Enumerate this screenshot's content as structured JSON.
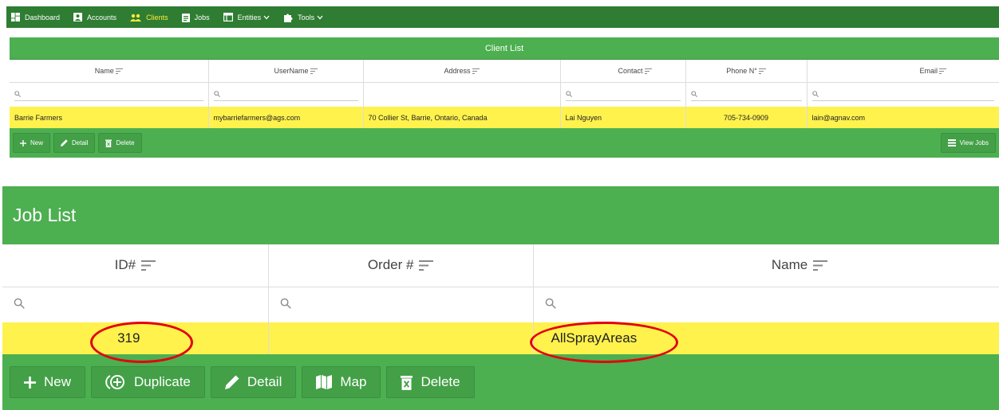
{
  "nav": {
    "items": [
      {
        "label": "Dashboard",
        "icon": "dashboard-icon"
      },
      {
        "label": "Accounts",
        "icon": "account-box-icon"
      },
      {
        "label": "Clients",
        "icon": "people-icon",
        "active": true
      },
      {
        "label": "Jobs",
        "icon": "clipboard-icon"
      },
      {
        "label": "Entities",
        "icon": "table-icon",
        "dropdown": true
      },
      {
        "label": "Tools",
        "icon": "puzzle-icon",
        "dropdown": true
      }
    ]
  },
  "client_list": {
    "title": "Client List",
    "columns": [
      "Name",
      "UserName",
      "Address",
      "Contact",
      "Phone N°",
      "Email"
    ],
    "rows": [
      {
        "name": "Barrie Farmers",
        "username": "mybarriefarmers@ags.com",
        "address": "70 Collier St, Barrie, Ontario, Canada",
        "contact": "Lai Nguyen",
        "phone": "705-734-0909",
        "email": "lain@agnav.com"
      }
    ],
    "toolbar": {
      "new": "New",
      "detail": "Detail",
      "delete": "Delete",
      "view_jobs": "View Jobs"
    }
  },
  "job_list": {
    "title": "Job List",
    "columns": [
      "ID#",
      "Order #",
      "Name"
    ],
    "rows": [
      {
        "id": "319",
        "order": "",
        "name": "AllSprayAreas"
      }
    ],
    "toolbar": {
      "new": "New",
      "duplicate": "Duplicate",
      "detail": "Detail",
      "map": "Map",
      "delete": "Delete"
    }
  },
  "colors": {
    "nav_bg": "#2e7d32",
    "panel_green": "#4caf50",
    "row_highlight": "#fff24d",
    "active_nav": "#ffeb3b",
    "annotation_red": "#e3000f"
  }
}
